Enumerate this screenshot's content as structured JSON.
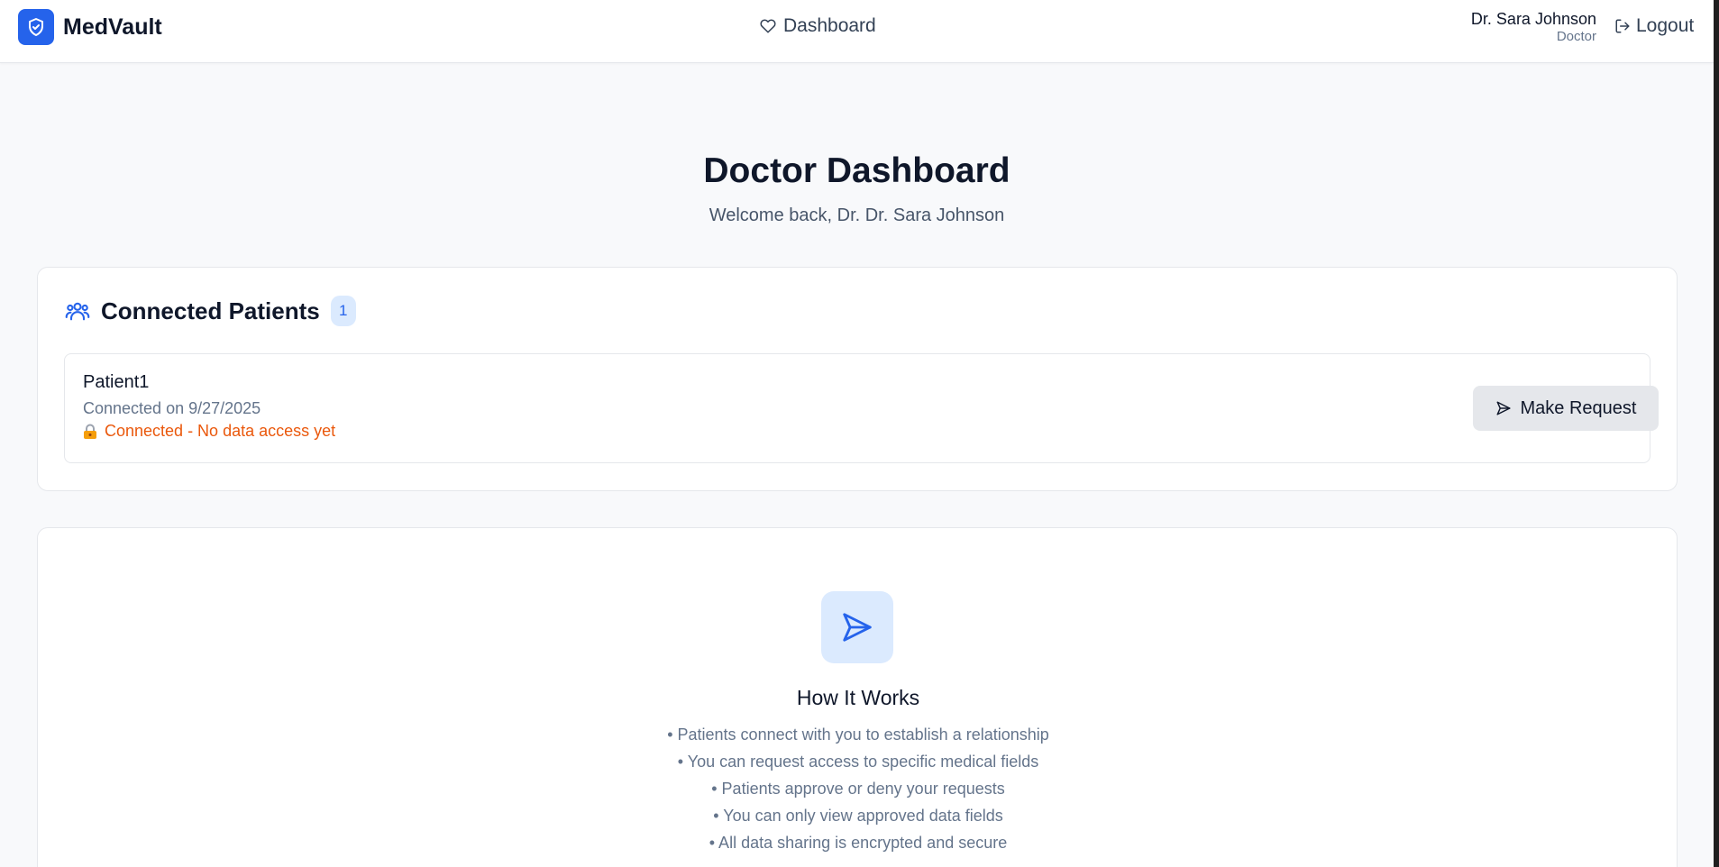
{
  "brand": {
    "name": "MedVault",
    "accent": "#2563eb"
  },
  "nav": {
    "dashboard_label": "Dashboard"
  },
  "user": {
    "name": "Dr. Sara Johnson",
    "role": "Doctor",
    "logout_label": "Logout"
  },
  "page": {
    "title": "Doctor Dashboard",
    "subtitle": "Welcome back, Dr. Dr. Sara Johnson"
  },
  "patients": {
    "title": "Connected Patients",
    "count": "1",
    "items": [
      {
        "name": "Patient1",
        "connected": "Connected on 9/27/2025",
        "status": "Connected - No data access yet",
        "status_icon": "lock-icon",
        "status_color": "#ea580c",
        "action_label": "Make Request"
      }
    ]
  },
  "how": {
    "title": "How It Works",
    "icon": "send-icon",
    "points": [
      "• Patients connect with you to establish a relationship",
      "• You can request access to specific medical fields",
      "• Patients approve or deny your requests",
      "• You can only view approved data fields",
      "• All data sharing is encrypted and secure"
    ]
  }
}
